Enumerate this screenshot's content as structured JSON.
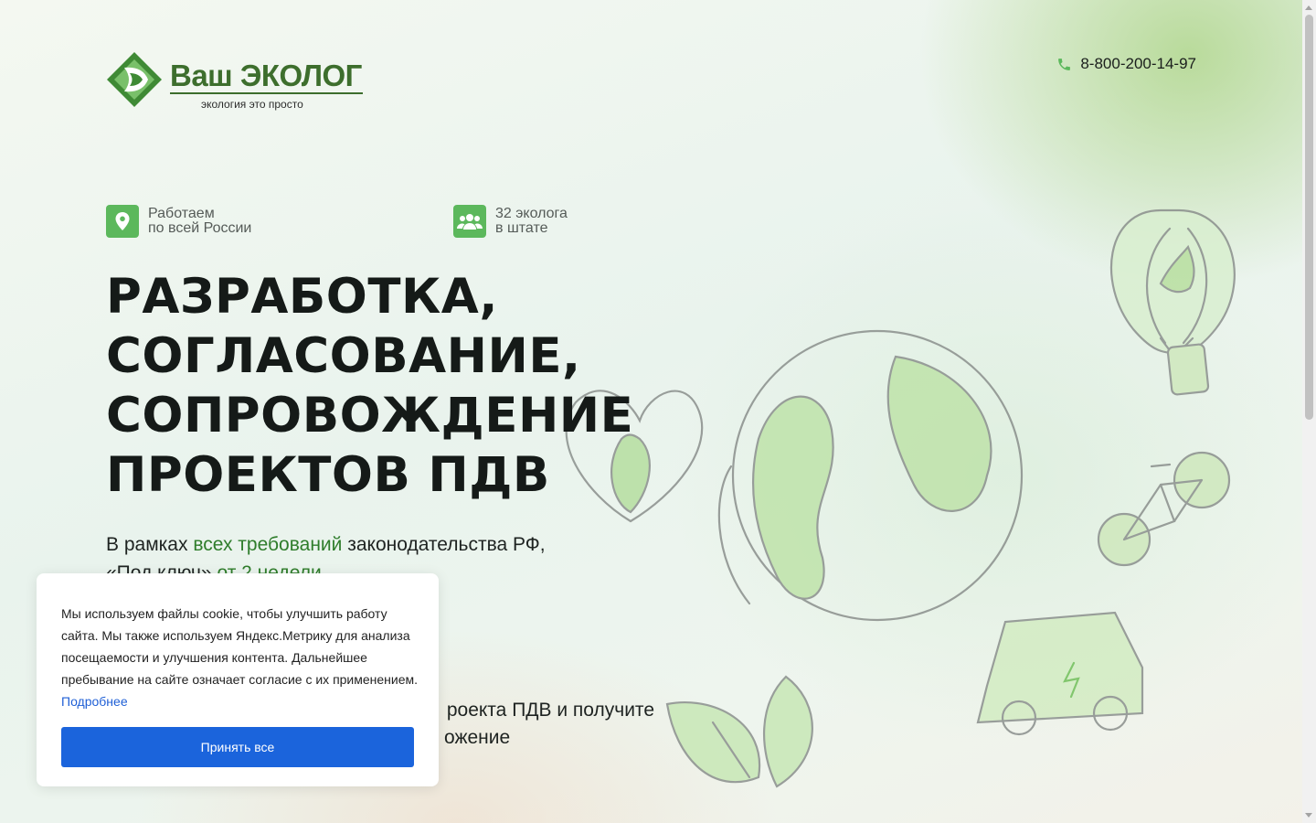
{
  "header": {
    "logo_title": "Ваш ЭКОЛОГ",
    "logo_tagline": "экология это просто",
    "phone": "8-800-200-14-97"
  },
  "features": [
    {
      "line1": "Работаем",
      "line2": "по всей России",
      "icon": "location-pin-icon"
    },
    {
      "line1": "32 эколога",
      "line2": "в штате",
      "icon": "team-icon"
    }
  ],
  "hero": {
    "headline": [
      "РАЗРАБОТКА,",
      "СОГЛАСОВАНИЕ,",
      "СОПРОВОЖДЕНИЕ",
      "ПРОЕКТОВ ПДВ"
    ],
    "sub_prefix": "В рамках ",
    "sub_highlight": "всех требований",
    "sub_suffix": " законодательства РФ,",
    "sub_line2_prefix": "«Под ключ» ",
    "sub_line2_highlight": "от 2 недели",
    "cta_line1": "роекта ПДВ и получите",
    "cta_line2": "ожение"
  },
  "cookie": {
    "text": "Мы используем файлы cookie, чтобы улучшить работу сайта. Мы также используем Яндекс.Метрику для анализа посещаемости и улучшения контента. Дальнейшее пребывание на сайте означает согласие с их применением.",
    "link": "Подробнее",
    "accept_button": "Принять все"
  },
  "colors": {
    "brand_green": "#3d6e2d",
    "accent_green": "#5cb85c",
    "button_blue": "#1b64dc"
  }
}
